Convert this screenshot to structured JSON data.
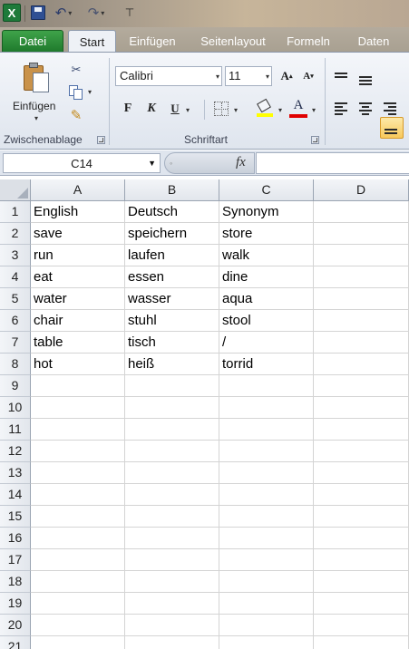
{
  "quick_access": {
    "app_icon": "excel-icon",
    "save_icon": "save-icon",
    "undo_icon": "undo-icon",
    "redo_icon": "redo-icon",
    "customize_icon": "customize-toolbar-icon"
  },
  "tabs": [
    {
      "label": "Datei",
      "active": false
    },
    {
      "label": "Start",
      "active": true
    },
    {
      "label": "Einfügen",
      "active": false
    },
    {
      "label": "Seitenlayout",
      "active": false
    },
    {
      "label": "Formeln",
      "active": false
    },
    {
      "label": "Daten",
      "active": false
    }
  ],
  "ribbon": {
    "clipboard": {
      "paste_label": "Einfügen",
      "group_label": "Zwischenablage"
    },
    "font": {
      "font_name": "Calibri",
      "font_size": "11",
      "bold": "F",
      "italic": "K",
      "underline": "U",
      "grow_label": "A",
      "shrink_label": "A",
      "font_color_label": "A",
      "fill_color": "#FFFF00",
      "font_color": "#E00000",
      "group_label": "Schriftart"
    }
  },
  "formula_bar": {
    "name_box": "C14",
    "fx_label": "fx",
    "formula": ""
  },
  "sheet": {
    "columns": [
      "A",
      "B",
      "C",
      "D"
    ],
    "row_numbers": [
      "1",
      "2",
      "3",
      "4",
      "5",
      "6",
      "7",
      "8",
      "9",
      "10",
      "11",
      "12",
      "13",
      "14",
      "15",
      "16",
      "17",
      "18",
      "19",
      "20",
      "21"
    ],
    "rows": [
      [
        "English",
        "Deutsch",
        "Synonym",
        ""
      ],
      [
        "save",
        "speichern",
        "store",
        ""
      ],
      [
        "run",
        "laufen",
        "walk",
        ""
      ],
      [
        "eat",
        "essen",
        "dine",
        ""
      ],
      [
        "water",
        "wasser",
        "aqua",
        ""
      ],
      [
        "chair",
        "stuhl",
        "stool",
        ""
      ],
      [
        "table",
        "tisch",
        "/",
        ""
      ],
      [
        "hot",
        "heiß",
        "torrid",
        ""
      ]
    ]
  }
}
